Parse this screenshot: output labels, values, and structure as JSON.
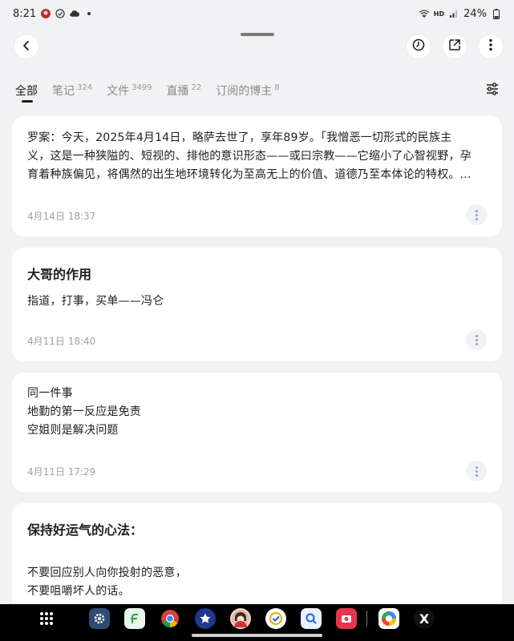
{
  "status_bar": {
    "time": "8:21",
    "battery": "24%",
    "icons": [
      "avatar-icon",
      "check-circle-icon",
      "cloud-icon",
      "dot-icon",
      "wifi-icon",
      "hd-icon",
      "signal-icon",
      "battery-icon"
    ]
  },
  "toolbar": {
    "back_icon": "arrow-left-icon",
    "history_icon": "clock-icon",
    "share_icon": "share-icon",
    "more_icon": "more-vertical-icon"
  },
  "tabs": [
    {
      "label": "全部",
      "count": "",
      "active": true
    },
    {
      "label": "笔记",
      "count": "324",
      "active": false
    },
    {
      "label": "文件",
      "count": "3499",
      "active": false
    },
    {
      "label": "直播",
      "count": "22",
      "active": false
    },
    {
      "label": "订阅的博主",
      "count": "8",
      "active": false
    }
  ],
  "filter_icon": "sliders-icon",
  "cards": [
    {
      "title": "",
      "lines": [
        "罗案：今天，2025年4月14日，略萨去世了，享年89岁。「我憎恶一切形式的民族主",
        "义，这是一种狭隘的、短视的、排他的意识形态——或曰宗教——它缩小了心智视野，孕",
        "育着种族偏见，将偶然的出生地环境转化为至高无上的价值、道德乃至本体论的特权。..."
      ],
      "date": "4月14日 18:37"
    },
    {
      "title": "大哥的作用",
      "lines": [
        "指道，打事，买单——冯仑"
      ],
      "date": "4月11日 18:40"
    },
    {
      "title": "",
      "lines": [
        "同一件事",
        "地勤的第一反应是免责",
        "空姐则是解决问题"
      ],
      "date": "4月11日 17:29"
    },
    {
      "title": "保持好运气的心法：",
      "lines": [
        "不要回应别人向你投射的恶意，",
        "不要咀嚼坏人的话。"
      ],
      "date": ""
    }
  ],
  "dock": {
    "apps": [
      "settings-icon",
      "feedly-icon",
      "chrome-icon",
      "star-app-icon",
      "avatar-app-icon",
      "tasks-icon",
      "search-app-icon",
      "camera-app-icon",
      "color-app-icon",
      "x-icon"
    ],
    "x_label": "X"
  }
}
